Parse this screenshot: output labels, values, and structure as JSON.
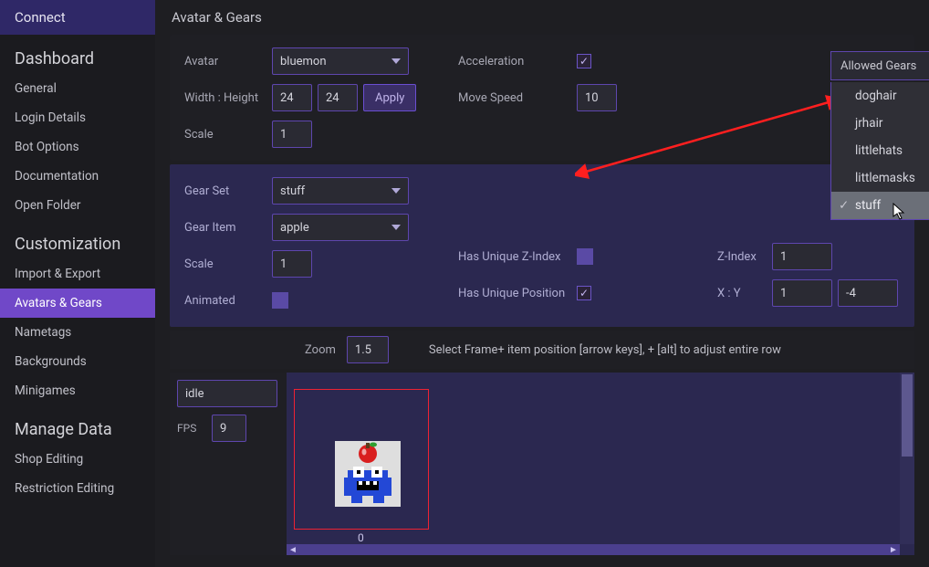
{
  "brand": "Connect",
  "page_title": "Avatar & Gears",
  "sidebar": {
    "groups": [
      {
        "title": "Dashboard",
        "items": [
          "General",
          "Login Details",
          "Bot Options",
          "Documentation",
          "Open Folder"
        ]
      },
      {
        "title": "Customization",
        "items": [
          "Import & Export",
          "Avatars & Gears",
          "Nametags",
          "Backgrounds",
          "Minigames"
        ],
        "active": "Avatars & Gears"
      },
      {
        "title": "Manage Data",
        "items": [
          "Shop Editing",
          "Restriction Editing"
        ]
      }
    ]
  },
  "avatar": {
    "avatar_label": "Avatar",
    "avatar_value": "bluemon",
    "wh_label": "Width : Height",
    "width": "24",
    "height": "24",
    "apply": "Apply",
    "scale_label": "Scale",
    "scale": "1",
    "accel_label": "Acceleration",
    "accel_checked": true,
    "move_label": "Move Speed",
    "move_speed": "10"
  },
  "allowed_gears": {
    "head": "Allowed Gears",
    "options": [
      "doghair",
      "jrhair",
      "littlehats",
      "littlemasks",
      "stuff"
    ],
    "selected": "stuff"
  },
  "gear": {
    "set_label": "Gear Set",
    "set_value": "stuff",
    "item_label": "Gear Item",
    "item_value": "apple",
    "scale_label": "Scale",
    "scale": "1",
    "animated_label": "Animated",
    "animated": false,
    "hz_label": "Has Unique Z-Index",
    "hz": false,
    "hp_label": "Has Unique Position",
    "hp": true,
    "z_label": "Z-Index",
    "z": "1",
    "xy_label": "X : Y",
    "x": "1",
    "y": "-4"
  },
  "zoom": {
    "label": "Zoom",
    "value": "1.5",
    "hint": "Select Frame+ item position [arrow keys], + [alt] to adjust entire row"
  },
  "frames": {
    "anim": "idle",
    "fps_label": "FPS",
    "fps": "9",
    "frame0": "0"
  }
}
